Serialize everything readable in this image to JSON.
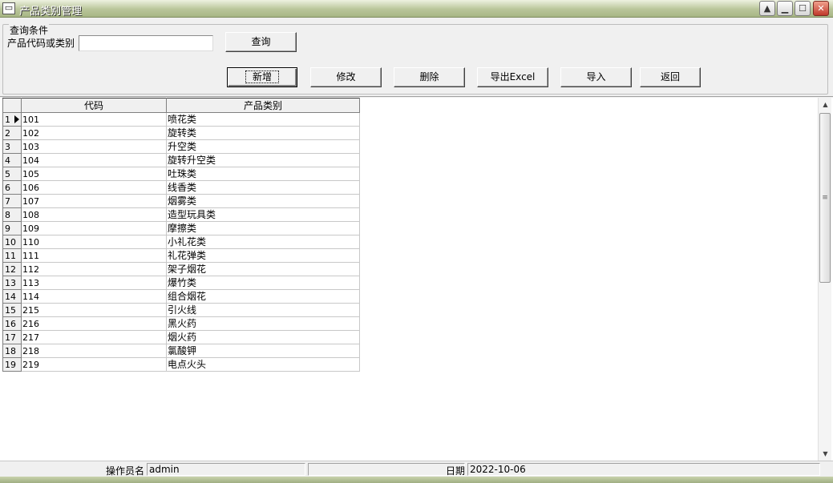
{
  "window": {
    "title": "产品类别管理",
    "system_icon": "window-menu-icon",
    "controls": {
      "minimize": "minimize-icon",
      "maximize": "maximize-icon",
      "close": "close-icon"
    }
  },
  "query": {
    "group_title": "查询条件",
    "field_label": "产品代码或类别",
    "field_value": "",
    "search_button": "查询"
  },
  "toolbar": {
    "add": "新增",
    "edit": "修改",
    "delete": "删除",
    "export": "导出Excel",
    "import": "导入",
    "back": "返回"
  },
  "grid": {
    "columns": [
      "代码",
      "产品类别"
    ],
    "rows": [
      {
        "n": "1",
        "code": "101",
        "category": "喷花类"
      },
      {
        "n": "2",
        "code": "102",
        "category": "旋转类"
      },
      {
        "n": "3",
        "code": "103",
        "category": "升空类"
      },
      {
        "n": "4",
        "code": "104",
        "category": "旋转升空类"
      },
      {
        "n": "5",
        "code": "105",
        "category": "吐珠类"
      },
      {
        "n": "6",
        "code": "106",
        "category": "线香类"
      },
      {
        "n": "7",
        "code": "107",
        "category": "烟雾类"
      },
      {
        "n": "8",
        "code": "108",
        "category": "造型玩具类"
      },
      {
        "n": "9",
        "code": "109",
        "category": "摩擦类"
      },
      {
        "n": "10",
        "code": "110",
        "category": "小礼花类"
      },
      {
        "n": "11",
        "code": "111",
        "category": "礼花弹类"
      },
      {
        "n": "12",
        "code": "112",
        "category": "架子烟花"
      },
      {
        "n": "13",
        "code": "113",
        "category": "爆竹类"
      },
      {
        "n": "14",
        "code": "114",
        "category": "组合烟花"
      },
      {
        "n": "15",
        "code": "215",
        "category": "引火线"
      },
      {
        "n": "16",
        "code": "216",
        "category": "黑火药"
      },
      {
        "n": "17",
        "code": "217",
        "category": "烟火药"
      },
      {
        "n": "18",
        "code": "218",
        "category": "氯酸钾"
      },
      {
        "n": "19",
        "code": "219",
        "category": "电点火头"
      }
    ]
  },
  "status": {
    "operator_label": "操作员名",
    "operator_value": "admin",
    "date_label": "日期",
    "date_value": "2022-10-06"
  }
}
